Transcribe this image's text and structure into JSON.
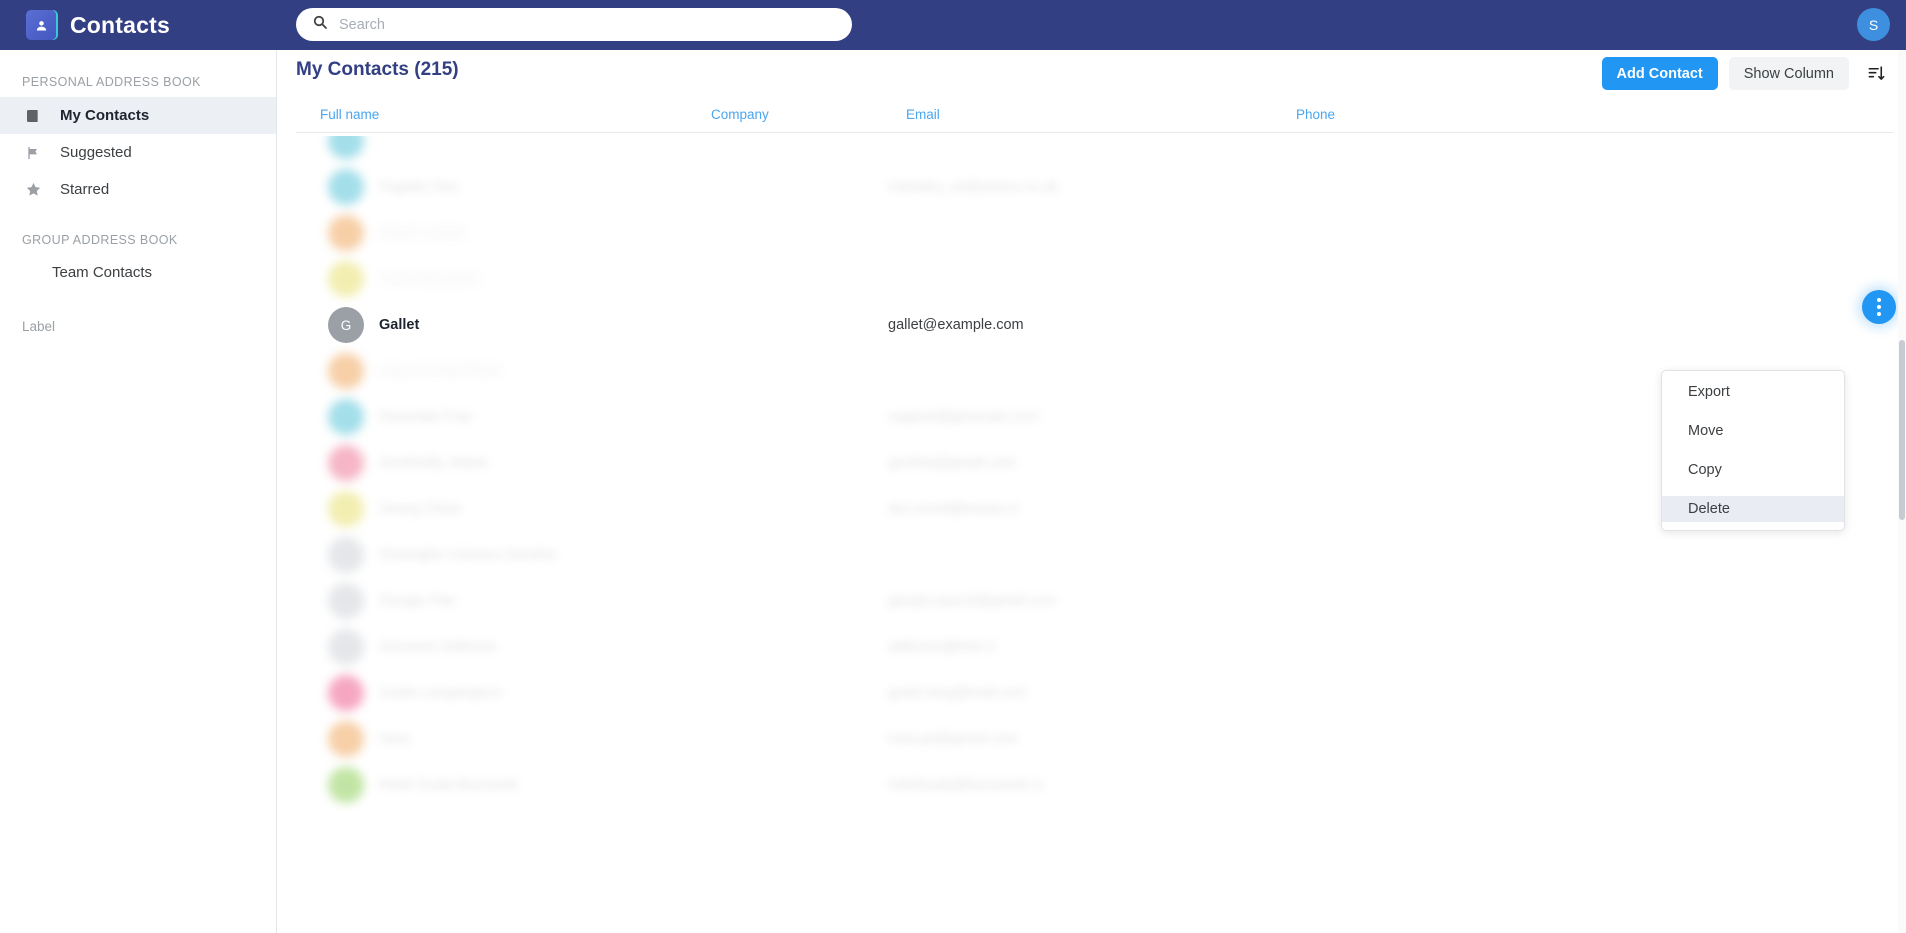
{
  "app": {
    "title": "Contacts",
    "logo_icon": "address-book-icon",
    "user_initial": "S"
  },
  "search": {
    "placeholder": "Search",
    "value": "",
    "icon": "search-icon"
  },
  "sidebar": {
    "section_personal": "PERSONAL ADDRESS BOOK",
    "section_group": "GROUP ADDRESS BOOK",
    "label_heading": "Label",
    "items": [
      {
        "label": "My Contacts",
        "icon": "book-icon",
        "active": true
      },
      {
        "label": "Suggested",
        "icon": "flag-icon",
        "active": false
      },
      {
        "label": "Starred",
        "icon": "star-icon",
        "active": false
      }
    ],
    "group_items": [
      {
        "label": "Team Contacts"
      }
    ]
  },
  "header": {
    "page_title": "My Contacts (215)",
    "add_contact_label": "Add Contact",
    "show_column_label": "Show Column",
    "sort_icon": "sort-descending-icon"
  },
  "table": {
    "columns": [
      {
        "key": "name",
        "label": "Full name"
      },
      {
        "key": "company",
        "label": "Company"
      },
      {
        "key": "email",
        "label": "Email"
      },
      {
        "key": "phone",
        "label": "Phone"
      }
    ],
    "rows": [
      {
        "initial": "",
        "color": "#58c4d8",
        "name": "",
        "company": "",
        "email": "",
        "phone": "",
        "blur": "b"
      },
      {
        "initial": "",
        "color": "#58c4d8",
        "name": "Fugahy Osa",
        "company": "",
        "email": "mylealry_ce@yahoo.co.uk",
        "phone": "",
        "blur": "a"
      },
      {
        "initial": "",
        "color": "#f0a860",
        "name": "Gbule Luinga",
        "company": "",
        "email": "",
        "phone": "",
        "blur": "b"
      },
      {
        "initial": "",
        "color": "#e8e070",
        "name": "Cura Alexandra",
        "company": "",
        "email": "",
        "phone": "",
        "blur": "b"
      },
      {
        "initial": "G",
        "color": "#9aa0a6",
        "name": "Gallet",
        "company": "",
        "email": "gallet@example.com",
        "phone": "",
        "blur": "none",
        "selected": true
      },
      {
        "initial": "",
        "color": "#f0a860",
        "name": "Gaza Fiorita Pitesti",
        "company": "",
        "email": "",
        "phone": "",
        "blur": "b"
      },
      {
        "initial": "",
        "color": "#58c4d8",
        "name": "Generale Fran",
        "company": "",
        "email": "support@generale.com",
        "phone": "",
        "blur": "a"
      },
      {
        "initial": "",
        "color": "#ef7b9a",
        "name": "Genthially, Marar",
        "company": "",
        "email": "genthia@gmail.com",
        "phone": "",
        "blur": "a"
      },
      {
        "initial": "",
        "color": "#e8e070",
        "name": "Georg Chiari",
        "company": "",
        "email": "dev.ucont@westa.ro",
        "phone": "",
        "blur": "a"
      },
      {
        "initial": "",
        "color": "#cfd3d8",
        "name": "Gheorghe Ciobanu Dumitra",
        "company": "",
        "email": "",
        "phone": "",
        "blur": "a"
      },
      {
        "initial": "",
        "color": "#cfd3d8",
        "name": "Giorgio Pau",
        "company": "",
        "email": "giorgio.pau10@gmail.com",
        "phone": "",
        "blur": "a"
      },
      {
        "initial": "",
        "color": "#cfd3d8",
        "name": "Giovanni Daltosso",
        "company": "",
        "email": "daltosso@bish.it",
        "phone": "",
        "blur": "a"
      },
      {
        "initial": "",
        "color": "#ef5f8f",
        "name": "Guido Langangiorn",
        "company": "",
        "email": "guido.lang@mail.com",
        "phone": "",
        "blur": "a"
      },
      {
        "initial": "",
        "color": "#f0a860",
        "name": "Hara",
        "company": "",
        "email": "hara.pd@gmail.com",
        "phone": "",
        "blur": "a"
      },
      {
        "initial": "",
        "color": "#8fcf5a",
        "name": "Hotel Scala Bucuresti",
        "company": "",
        "email": "hotelscala@bucuresti.ro",
        "phone": "",
        "blur": "a"
      }
    ]
  },
  "context_menu": {
    "items": [
      {
        "label": "Export",
        "highlighted": false
      },
      {
        "label": "Move",
        "highlighted": false
      },
      {
        "label": "Copy",
        "highlighted": false
      },
      {
        "label": "Delete",
        "highlighted": true
      }
    ]
  },
  "fab": {
    "icon": "more-vertical-icon"
  },
  "colors": {
    "topbar": "#333f83",
    "accent_blue": "#2196f3",
    "link_blue": "#4aa6ef",
    "title_navy": "#333f83"
  }
}
